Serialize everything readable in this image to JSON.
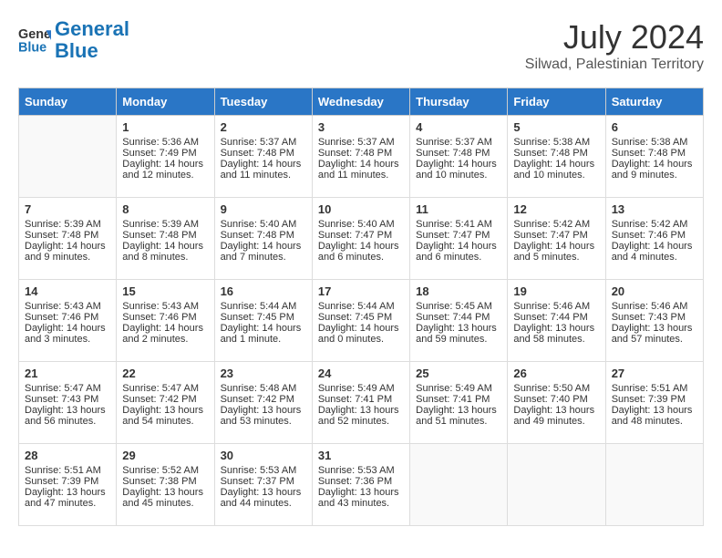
{
  "header": {
    "logo_line1": "General",
    "logo_line2": "Blue",
    "month_year": "July 2024",
    "location": "Silwad, Palestinian Territory"
  },
  "weekdays": [
    "Sunday",
    "Monday",
    "Tuesday",
    "Wednesday",
    "Thursday",
    "Friday",
    "Saturday"
  ],
  "weeks": [
    [
      {
        "day": "",
        "sunrise": "",
        "sunset": "",
        "daylight": ""
      },
      {
        "day": "1",
        "sunrise": "Sunrise: 5:36 AM",
        "sunset": "Sunset: 7:49 PM",
        "daylight": "Daylight: 14 hours and 12 minutes."
      },
      {
        "day": "2",
        "sunrise": "Sunrise: 5:37 AM",
        "sunset": "Sunset: 7:48 PM",
        "daylight": "Daylight: 14 hours and 11 minutes."
      },
      {
        "day": "3",
        "sunrise": "Sunrise: 5:37 AM",
        "sunset": "Sunset: 7:48 PM",
        "daylight": "Daylight: 14 hours and 11 minutes."
      },
      {
        "day": "4",
        "sunrise": "Sunrise: 5:37 AM",
        "sunset": "Sunset: 7:48 PM",
        "daylight": "Daylight: 14 hours and 10 minutes."
      },
      {
        "day": "5",
        "sunrise": "Sunrise: 5:38 AM",
        "sunset": "Sunset: 7:48 PM",
        "daylight": "Daylight: 14 hours and 10 minutes."
      },
      {
        "day": "6",
        "sunrise": "Sunrise: 5:38 AM",
        "sunset": "Sunset: 7:48 PM",
        "daylight": "Daylight: 14 hours and 9 minutes."
      }
    ],
    [
      {
        "day": "7",
        "sunrise": "Sunrise: 5:39 AM",
        "sunset": "Sunset: 7:48 PM",
        "daylight": "Daylight: 14 hours and 9 minutes."
      },
      {
        "day": "8",
        "sunrise": "Sunrise: 5:39 AM",
        "sunset": "Sunset: 7:48 PM",
        "daylight": "Daylight: 14 hours and 8 minutes."
      },
      {
        "day": "9",
        "sunrise": "Sunrise: 5:40 AM",
        "sunset": "Sunset: 7:48 PM",
        "daylight": "Daylight: 14 hours and 7 minutes."
      },
      {
        "day": "10",
        "sunrise": "Sunrise: 5:40 AM",
        "sunset": "Sunset: 7:47 PM",
        "daylight": "Daylight: 14 hours and 6 minutes."
      },
      {
        "day": "11",
        "sunrise": "Sunrise: 5:41 AM",
        "sunset": "Sunset: 7:47 PM",
        "daylight": "Daylight: 14 hours and 6 minutes."
      },
      {
        "day": "12",
        "sunrise": "Sunrise: 5:42 AM",
        "sunset": "Sunset: 7:47 PM",
        "daylight": "Daylight: 14 hours and 5 minutes."
      },
      {
        "day": "13",
        "sunrise": "Sunrise: 5:42 AM",
        "sunset": "Sunset: 7:46 PM",
        "daylight": "Daylight: 14 hours and 4 minutes."
      }
    ],
    [
      {
        "day": "14",
        "sunrise": "Sunrise: 5:43 AM",
        "sunset": "Sunset: 7:46 PM",
        "daylight": "Daylight: 14 hours and 3 minutes."
      },
      {
        "day": "15",
        "sunrise": "Sunrise: 5:43 AM",
        "sunset": "Sunset: 7:46 PM",
        "daylight": "Daylight: 14 hours and 2 minutes."
      },
      {
        "day": "16",
        "sunrise": "Sunrise: 5:44 AM",
        "sunset": "Sunset: 7:45 PM",
        "daylight": "Daylight: 14 hours and 1 minute."
      },
      {
        "day": "17",
        "sunrise": "Sunrise: 5:44 AM",
        "sunset": "Sunset: 7:45 PM",
        "daylight": "Daylight: 14 hours and 0 minutes."
      },
      {
        "day": "18",
        "sunrise": "Sunrise: 5:45 AM",
        "sunset": "Sunset: 7:44 PM",
        "daylight": "Daylight: 13 hours and 59 minutes."
      },
      {
        "day": "19",
        "sunrise": "Sunrise: 5:46 AM",
        "sunset": "Sunset: 7:44 PM",
        "daylight": "Daylight: 13 hours and 58 minutes."
      },
      {
        "day": "20",
        "sunrise": "Sunrise: 5:46 AM",
        "sunset": "Sunset: 7:43 PM",
        "daylight": "Daylight: 13 hours and 57 minutes."
      }
    ],
    [
      {
        "day": "21",
        "sunrise": "Sunrise: 5:47 AM",
        "sunset": "Sunset: 7:43 PM",
        "daylight": "Daylight: 13 hours and 56 minutes."
      },
      {
        "day": "22",
        "sunrise": "Sunrise: 5:47 AM",
        "sunset": "Sunset: 7:42 PM",
        "daylight": "Daylight: 13 hours and 54 minutes."
      },
      {
        "day": "23",
        "sunrise": "Sunrise: 5:48 AM",
        "sunset": "Sunset: 7:42 PM",
        "daylight": "Daylight: 13 hours and 53 minutes."
      },
      {
        "day": "24",
        "sunrise": "Sunrise: 5:49 AM",
        "sunset": "Sunset: 7:41 PM",
        "daylight": "Daylight: 13 hours and 52 minutes."
      },
      {
        "day": "25",
        "sunrise": "Sunrise: 5:49 AM",
        "sunset": "Sunset: 7:41 PM",
        "daylight": "Daylight: 13 hours and 51 minutes."
      },
      {
        "day": "26",
        "sunrise": "Sunrise: 5:50 AM",
        "sunset": "Sunset: 7:40 PM",
        "daylight": "Daylight: 13 hours and 49 minutes."
      },
      {
        "day": "27",
        "sunrise": "Sunrise: 5:51 AM",
        "sunset": "Sunset: 7:39 PM",
        "daylight": "Daylight: 13 hours and 48 minutes."
      }
    ],
    [
      {
        "day": "28",
        "sunrise": "Sunrise: 5:51 AM",
        "sunset": "Sunset: 7:39 PM",
        "daylight": "Daylight: 13 hours and 47 minutes."
      },
      {
        "day": "29",
        "sunrise": "Sunrise: 5:52 AM",
        "sunset": "Sunset: 7:38 PM",
        "daylight": "Daylight: 13 hours and 45 minutes."
      },
      {
        "day": "30",
        "sunrise": "Sunrise: 5:53 AM",
        "sunset": "Sunset: 7:37 PM",
        "daylight": "Daylight: 13 hours and 44 minutes."
      },
      {
        "day": "31",
        "sunrise": "Sunrise: 5:53 AM",
        "sunset": "Sunset: 7:36 PM",
        "daylight": "Daylight: 13 hours and 43 minutes."
      },
      {
        "day": "",
        "sunrise": "",
        "sunset": "",
        "daylight": ""
      },
      {
        "day": "",
        "sunrise": "",
        "sunset": "",
        "daylight": ""
      },
      {
        "day": "",
        "sunrise": "",
        "sunset": "",
        "daylight": ""
      }
    ]
  ]
}
